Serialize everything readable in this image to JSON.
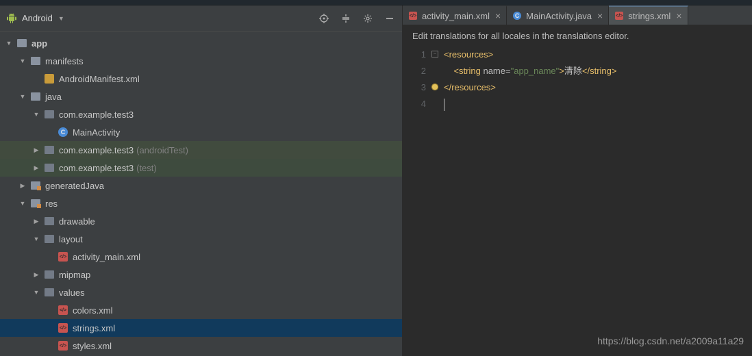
{
  "sidebar": {
    "title": "Android",
    "items": {
      "app": "app",
      "manifests": "manifests",
      "manifest_file": "AndroidManifest.xml",
      "java": "java",
      "pkg_main": "com.example.test3",
      "main_activity": "MainActivity",
      "pkg_android_test": "com.example.test3",
      "pkg_android_test_suffix": "(androidTest)",
      "pkg_test": "com.example.test3",
      "pkg_test_suffix": "(test)",
      "generated_java": "generatedJava",
      "res": "res",
      "drawable": "drawable",
      "layout": "layout",
      "activity_main": "activity_main.xml",
      "mipmap": "mipmap",
      "values": "values",
      "colors": "colors.xml",
      "strings": "strings.xml",
      "styles": "styles.xml"
    }
  },
  "tabs": {
    "t1": "activity_main.xml",
    "t2": "MainActivity.java",
    "t3": "strings.xml"
  },
  "hint": "Edit translations for all locales in the translations editor.",
  "code": {
    "ln1": "1",
    "ln2": "2",
    "ln3": "3",
    "ln4": "4",
    "l1_open": "<",
    "l1_tag": "resources",
    "l1_close": ">",
    "l2_pre": "    <",
    "l2_tag": "string",
    "l2_sp": " ",
    "l2_attr": "name=",
    "l2_val": "\"app_name\"",
    "l2_mid": ">",
    "l2_txt": "清除",
    "l2_lt": "</",
    "l2_endtag": "string",
    "l2_gt": ">",
    "l3_open": "</",
    "l3_tag": "resources",
    "l3_close": ">"
  },
  "watermark": "https://blog.csdn.net/a2009a11a29"
}
